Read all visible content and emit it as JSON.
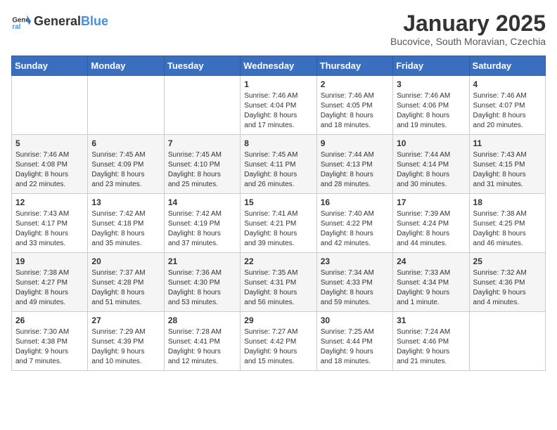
{
  "header": {
    "logo_general": "General",
    "logo_blue": "Blue",
    "month_title": "January 2025",
    "location": "Bucovice, South Moravian, Czechia"
  },
  "weekdays": [
    "Sunday",
    "Monday",
    "Tuesday",
    "Wednesday",
    "Thursday",
    "Friday",
    "Saturday"
  ],
  "weeks": [
    [
      {
        "day": "",
        "info": ""
      },
      {
        "day": "",
        "info": ""
      },
      {
        "day": "",
        "info": ""
      },
      {
        "day": "1",
        "info": "Sunrise: 7:46 AM\nSunset: 4:04 PM\nDaylight: 8 hours\nand 17 minutes."
      },
      {
        "day": "2",
        "info": "Sunrise: 7:46 AM\nSunset: 4:05 PM\nDaylight: 8 hours\nand 18 minutes."
      },
      {
        "day": "3",
        "info": "Sunrise: 7:46 AM\nSunset: 4:06 PM\nDaylight: 8 hours\nand 19 minutes."
      },
      {
        "day": "4",
        "info": "Sunrise: 7:46 AM\nSunset: 4:07 PM\nDaylight: 8 hours\nand 20 minutes."
      }
    ],
    [
      {
        "day": "5",
        "info": "Sunrise: 7:46 AM\nSunset: 4:08 PM\nDaylight: 8 hours\nand 22 minutes."
      },
      {
        "day": "6",
        "info": "Sunrise: 7:45 AM\nSunset: 4:09 PM\nDaylight: 8 hours\nand 23 minutes."
      },
      {
        "day": "7",
        "info": "Sunrise: 7:45 AM\nSunset: 4:10 PM\nDaylight: 8 hours\nand 25 minutes."
      },
      {
        "day": "8",
        "info": "Sunrise: 7:45 AM\nSunset: 4:11 PM\nDaylight: 8 hours\nand 26 minutes."
      },
      {
        "day": "9",
        "info": "Sunrise: 7:44 AM\nSunset: 4:13 PM\nDaylight: 8 hours\nand 28 minutes."
      },
      {
        "day": "10",
        "info": "Sunrise: 7:44 AM\nSunset: 4:14 PM\nDaylight: 8 hours\nand 30 minutes."
      },
      {
        "day": "11",
        "info": "Sunrise: 7:43 AM\nSunset: 4:15 PM\nDaylight: 8 hours\nand 31 minutes."
      }
    ],
    [
      {
        "day": "12",
        "info": "Sunrise: 7:43 AM\nSunset: 4:17 PM\nDaylight: 8 hours\nand 33 minutes."
      },
      {
        "day": "13",
        "info": "Sunrise: 7:42 AM\nSunset: 4:18 PM\nDaylight: 8 hours\nand 35 minutes."
      },
      {
        "day": "14",
        "info": "Sunrise: 7:42 AM\nSunset: 4:19 PM\nDaylight: 8 hours\nand 37 minutes."
      },
      {
        "day": "15",
        "info": "Sunrise: 7:41 AM\nSunset: 4:21 PM\nDaylight: 8 hours\nand 39 minutes."
      },
      {
        "day": "16",
        "info": "Sunrise: 7:40 AM\nSunset: 4:22 PM\nDaylight: 8 hours\nand 42 minutes."
      },
      {
        "day": "17",
        "info": "Sunrise: 7:39 AM\nSunset: 4:24 PM\nDaylight: 8 hours\nand 44 minutes."
      },
      {
        "day": "18",
        "info": "Sunrise: 7:38 AM\nSunset: 4:25 PM\nDaylight: 8 hours\nand 46 minutes."
      }
    ],
    [
      {
        "day": "19",
        "info": "Sunrise: 7:38 AM\nSunset: 4:27 PM\nDaylight: 8 hours\nand 49 minutes."
      },
      {
        "day": "20",
        "info": "Sunrise: 7:37 AM\nSunset: 4:28 PM\nDaylight: 8 hours\nand 51 minutes."
      },
      {
        "day": "21",
        "info": "Sunrise: 7:36 AM\nSunset: 4:30 PM\nDaylight: 8 hours\nand 53 minutes."
      },
      {
        "day": "22",
        "info": "Sunrise: 7:35 AM\nSunset: 4:31 PM\nDaylight: 8 hours\nand 56 minutes."
      },
      {
        "day": "23",
        "info": "Sunrise: 7:34 AM\nSunset: 4:33 PM\nDaylight: 8 hours\nand 59 minutes."
      },
      {
        "day": "24",
        "info": "Sunrise: 7:33 AM\nSunset: 4:34 PM\nDaylight: 9 hours\nand 1 minute."
      },
      {
        "day": "25",
        "info": "Sunrise: 7:32 AM\nSunset: 4:36 PM\nDaylight: 9 hours\nand 4 minutes."
      }
    ],
    [
      {
        "day": "26",
        "info": "Sunrise: 7:30 AM\nSunset: 4:38 PM\nDaylight: 9 hours\nand 7 minutes."
      },
      {
        "day": "27",
        "info": "Sunrise: 7:29 AM\nSunset: 4:39 PM\nDaylight: 9 hours\nand 10 minutes."
      },
      {
        "day": "28",
        "info": "Sunrise: 7:28 AM\nSunset: 4:41 PM\nDaylight: 9 hours\nand 12 minutes."
      },
      {
        "day": "29",
        "info": "Sunrise: 7:27 AM\nSunset: 4:42 PM\nDaylight: 9 hours\nand 15 minutes."
      },
      {
        "day": "30",
        "info": "Sunrise: 7:25 AM\nSunset: 4:44 PM\nDaylight: 9 hours\nand 18 minutes."
      },
      {
        "day": "31",
        "info": "Sunrise: 7:24 AM\nSunset: 4:46 PM\nDaylight: 9 hours\nand 21 minutes."
      },
      {
        "day": "",
        "info": ""
      }
    ]
  ]
}
